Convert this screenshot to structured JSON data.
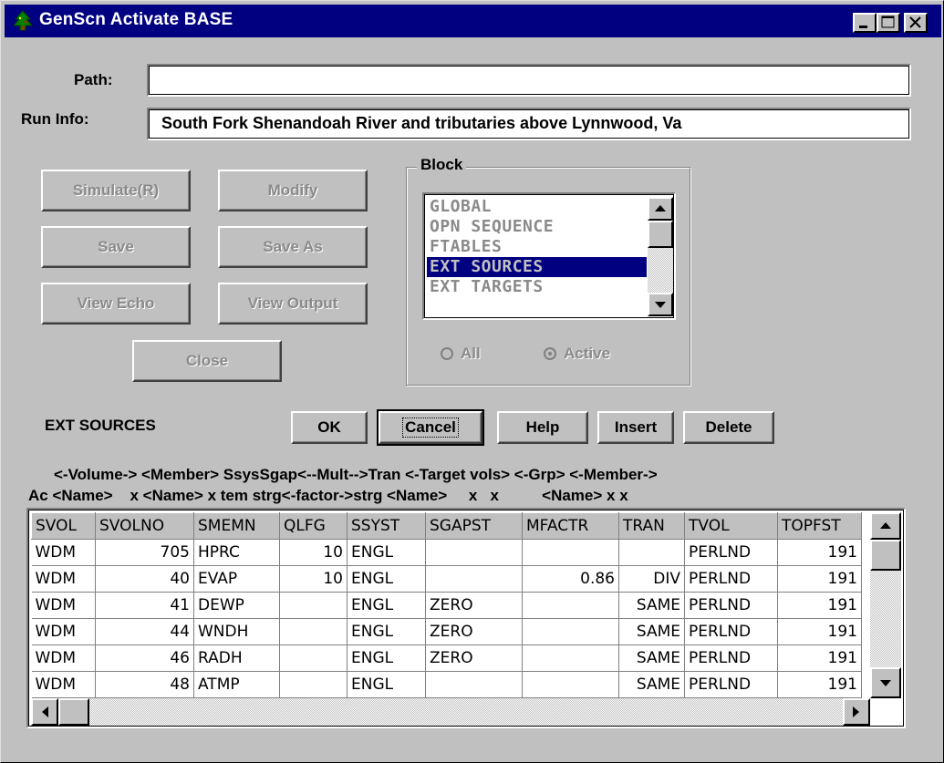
{
  "window": {
    "title": "GenScn Activate BASE",
    "icon": "tree-icon"
  },
  "path": {
    "label": "Path:",
    "value": ""
  },
  "run_info": {
    "label": "Run Info:",
    "value": "South Fork Shenandoah River and tributaries above Lynnwood, Va"
  },
  "buttons": {
    "simulate": "Simulate(R)",
    "modify": "Modify",
    "save": "Save",
    "save_as": "Save As",
    "view_echo": "View Echo",
    "view_output": "View Output",
    "close": "Close"
  },
  "block": {
    "title": "Block",
    "items": [
      "GLOBAL",
      "OPN SEQUENCE",
      "FTABLES",
      "EXT SOURCES",
      "EXT TARGETS"
    ],
    "selected": "EXT SOURCES",
    "radio_all": "All",
    "radio_active": "Active",
    "radio_selected": "Active"
  },
  "section": {
    "title": "EXT SOURCES",
    "ok": "OK",
    "cancel": "Cancel",
    "help": "Help",
    "insert": "Insert",
    "delete": "Delete"
  },
  "header_lines": [
    "<-Volume-> <Member> SsysSgap<--Mult-->Tran <-Target vols> <-Grp> <-Member->",
    "Ac <Name>    x <Name> x tem strg<-factor->strg <Name>     x   x          <Name> x x"
  ],
  "table": {
    "columns": [
      "SVOL",
      "SVOLNO",
      "SMEMN",
      "QLFG",
      "SSYST",
      "SGAPST",
      "MFACTR",
      "TRAN",
      "TVOL",
      "TOPFST"
    ],
    "rows": [
      [
        "WDM",
        "705",
        "HPRC",
        "10",
        "ENGL",
        "",
        "",
        "",
        "PERLND",
        "191"
      ],
      [
        "WDM",
        "40",
        "EVAP",
        "10",
        "ENGL",
        "",
        "0.86",
        "DIV",
        "PERLND",
        "191"
      ],
      [
        "WDM",
        "41",
        "DEWP",
        "",
        "ENGL",
        "ZERO",
        "",
        "SAME",
        "PERLND",
        "191"
      ],
      [
        "WDM",
        "44",
        "WNDH",
        "",
        "ENGL",
        "ZERO",
        "",
        "SAME",
        "PERLND",
        "191"
      ],
      [
        "WDM",
        "46",
        "RADH",
        "",
        "ENGL",
        "ZERO",
        "",
        "SAME",
        "PERLND",
        "191"
      ],
      [
        "WDM",
        "48",
        "ATMP",
        "",
        "ENGL",
        "",
        "",
        "SAME",
        "PERLND",
        "191"
      ]
    ]
  }
}
